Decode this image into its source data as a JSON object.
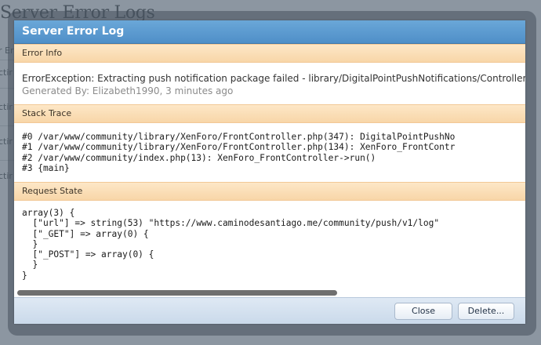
{
  "background": {
    "title": "Server Error Logs",
    "row_fragments": [
      "r Er",
      "ctir",
      "ctir",
      "ctir",
      "ctir"
    ]
  },
  "dialog": {
    "title": "Server Error Log",
    "error_info": {
      "header": "Error Info",
      "message": "ErrorException: Extracting push notification package failed - library/DigitalPointPushNotifications/ControllerP",
      "generated_by": "Generated By: Elizabeth1990, 3 minutes ago"
    },
    "stack_trace": {
      "header": "Stack Trace",
      "text": "#0 /var/www/community/library/XenForo/FrontController.php(347): DigitalPointPushNo\n#1 /var/www/community/library/XenForo/FrontController.php(134): XenForo_FrontContr\n#2 /var/www/community/index.php(13): XenForo_FrontController->run()\n#3 {main}"
    },
    "request_state": {
      "header": "Request State",
      "text": "array(3) {\n  [\"url\"] => string(53) \"https://www.caminodesantiago.me/community/push/v1/log\"\n  [\"_GET\"] => array(0) {\n  }\n  [\"_POST\"] => array(0) {\n  }\n}"
    },
    "buttons": {
      "close": "Close",
      "delete": "Delete..."
    }
  }
}
